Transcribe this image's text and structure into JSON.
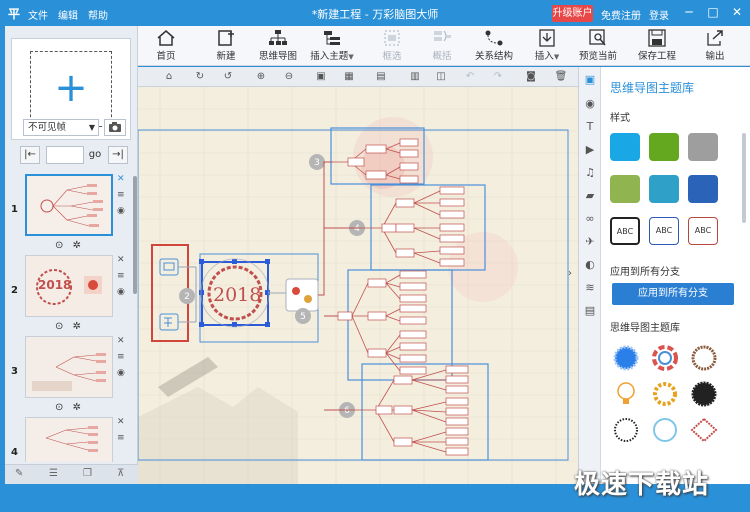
{
  "titlebar": {
    "logo": "平",
    "menu": [
      "文件",
      "编辑",
      "帮助"
    ],
    "title": "*新建工程 - 万彩脑图大师",
    "upgrade": "升级账户",
    "register": "免费注册",
    "login": "登录",
    "window_buttons": [
      "─",
      "□",
      "✕"
    ]
  },
  "toolbar": {
    "items": [
      {
        "label": "首页",
        "icon": "home-icon"
      },
      {
        "label": "新建",
        "icon": "new-file-icon"
      },
      {
        "label": "思维导图",
        "icon": "mindmap-icon"
      },
      {
        "label": "插入主题",
        "icon": "insert-topic-icon"
      },
      {
        "label": "框选",
        "icon": "frame-select-icon",
        "disabled": true
      },
      {
        "label": "概括",
        "icon": "summary-icon",
        "disabled": true
      },
      {
        "label": "关系结构",
        "icon": "relation-icon"
      },
      {
        "label": "插入",
        "icon": "insert-icon"
      },
      {
        "label": "预览当前",
        "icon": "preview-icon"
      },
      {
        "label": "保存工程",
        "icon": "save-icon"
      },
      {
        "label": "输出",
        "icon": "export-icon"
      }
    ]
  },
  "left_panel": {
    "add_slide_symbol": "+",
    "visibility_select": "不可见帧",
    "pager": {
      "first": "|←",
      "go": "go",
      "last": "→|"
    },
    "slides": [
      {
        "number": "1",
        "active": true
      },
      {
        "number": "2",
        "active": false,
        "thumb_text": "2018"
      },
      {
        "number": "3",
        "active": false
      },
      {
        "number": "4",
        "active": false
      }
    ]
  },
  "canvas": {
    "center_label": "2018",
    "markers": [
      "2",
      "3",
      "4",
      "5",
      "6"
    ]
  },
  "right_panel": {
    "title": "思维导图主题库",
    "style_section": "样式",
    "swatch_colors": [
      "#1aa7e5",
      "#63a81e",
      "#9e9e9e",
      "#8fb450",
      "#2fa0c8",
      "#2b63b9"
    ],
    "abc_label": "ABC",
    "apply_section": "应用到所有分支",
    "apply_button": "应用到所有分支",
    "theme_section": "思维导图主题库"
  },
  "watermark": "极速下载站",
  "colors": {
    "accent": "#2a90d8",
    "upgrade": "#e84848",
    "selection": "#2b5bd8",
    "branch_red": "#c0504d",
    "frame_blue": "#4a90d9"
  }
}
